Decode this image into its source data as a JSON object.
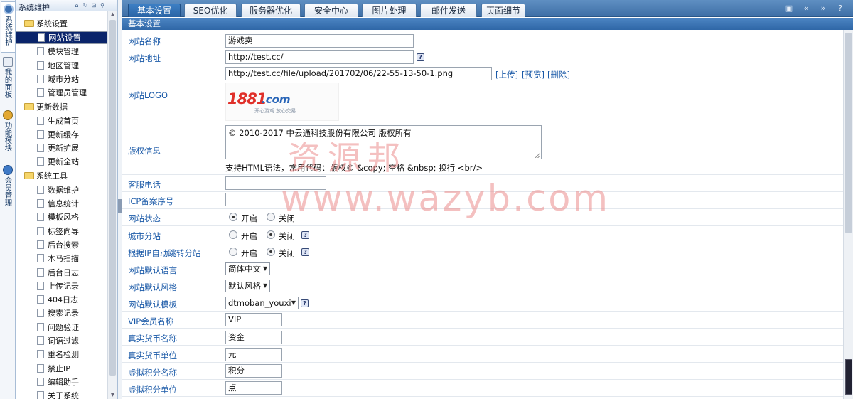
{
  "vertical_tabs": [
    {
      "label": "系统维护",
      "icon": "clock-icon"
    },
    {
      "label": "我的面板",
      "icon": "home-icon"
    },
    {
      "label": "功能模块",
      "icon": "gear-icon"
    },
    {
      "label": "会员管理",
      "icon": "user-icon"
    }
  ],
  "tree": {
    "title": "系统维护",
    "groups": [
      {
        "label": "系统设置",
        "items": [
          "网站设置",
          "模块管理",
          "地区管理",
          "城市分站",
          "管理员管理"
        ]
      },
      {
        "label": "更新数据",
        "items": [
          "生成首页",
          "更新缓存",
          "更新扩展",
          "更新全站"
        ]
      },
      {
        "label": "系统工具",
        "items": [
          "数据维护",
          "信息统计",
          "模板风格",
          "标签向导",
          "后台搜索",
          "木马扫描",
          "后台日志",
          "上传记录",
          "404日志",
          "搜索记录",
          "问题验证",
          "词语过滤",
          "重名检测",
          "禁止IP",
          "编辑助手",
          "关于系统"
        ]
      }
    ],
    "selected": "网站设置"
  },
  "tabs": [
    "基本设置",
    "SEO优化",
    "服务器优化",
    "安全中心",
    "图片处理",
    "邮件发送",
    "页面细节"
  ],
  "active_tab": "基本设置",
  "section_title": "基本设置",
  "form": {
    "site_name": {
      "label": "网站名称",
      "value": "游戏卖"
    },
    "site_url": {
      "label": "网站地址",
      "value": "http://test.cc/"
    },
    "site_logo": {
      "label": "网站LOGO",
      "value": "http://test.cc/file/upload/201702/06/22-55-13-50-1.png",
      "actions": [
        "[上传]",
        "[预览]",
        "[删除]"
      ],
      "logo_text": "1881",
      "logo_com": ".com",
      "logo_tagline": "开心游戏 放心交易"
    },
    "copyright": {
      "label": "版权信息",
      "value": "© 2010-2017 中云通科技股份有限公司 版权所有",
      "hint": "支持HTML语法，常用代码：版权© &copy; 空格 &nbsp; 换行 <br/>"
    },
    "service_phone": {
      "label": "客服电话",
      "value": ""
    },
    "icp": {
      "label": "ICP备案序号",
      "value": ""
    },
    "site_status": {
      "label": "网站状态",
      "options": [
        "开启",
        "关闭"
      ],
      "selected": "开启"
    },
    "city_station": {
      "label": "城市分站",
      "options": [
        "开启",
        "关闭"
      ],
      "selected": "关闭"
    },
    "ip_redirect": {
      "label": "根据IP自动跳转分站",
      "options": [
        "开启",
        "关闭"
      ],
      "selected": "关闭"
    },
    "default_language": {
      "label": "网站默认语言",
      "value": "简体中文"
    },
    "default_style": {
      "label": "网站默认风格",
      "value": "默认风格"
    },
    "default_template": {
      "label": "网站默认模板",
      "value": "dtmoban_youxi"
    },
    "vip_name": {
      "label": "VIP会员名称",
      "value": "VIP"
    },
    "real_currency_name": {
      "label": "真实货币名称",
      "value": "资金"
    },
    "real_currency_unit": {
      "label": "真实货币单位",
      "value": "元"
    },
    "virtual_points_name": {
      "label": "虚拟积分名称",
      "value": "积分"
    },
    "virtual_points_unit": {
      "label": "虚拟积分单位",
      "value": "点"
    }
  },
  "watermark": {
    "line1": "资源邦",
    "line2": "www.wazyb.com"
  },
  "colors": {
    "accent": "#2f67a7",
    "label": "#1b5aa8",
    "selected": "#0a246a"
  }
}
